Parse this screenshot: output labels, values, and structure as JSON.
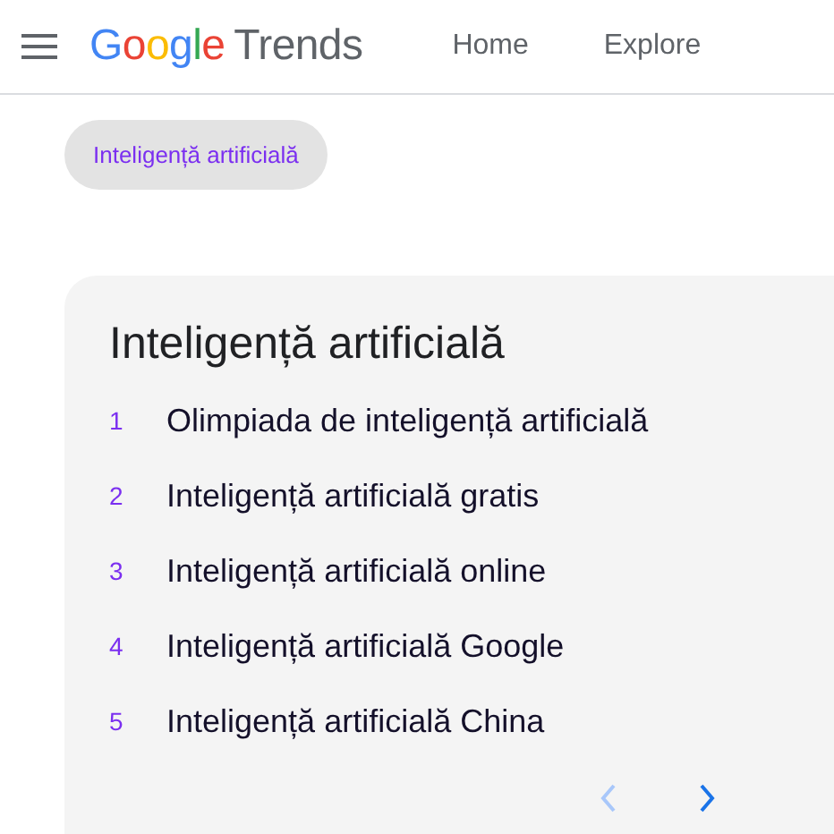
{
  "header": {
    "logo_letters": [
      {
        "text": "G",
        "color": "#4285f4"
      },
      {
        "text": "o",
        "color": "#ea4335"
      },
      {
        "text": "o",
        "color": "#fbbc05"
      },
      {
        "text": "g",
        "color": "#4285f4"
      },
      {
        "text": "l",
        "color": "#34a853"
      },
      {
        "text": "e",
        "color": "#ea4335"
      }
    ],
    "logo_product": "Trends",
    "nav": [
      {
        "label": "Home"
      },
      {
        "label": "Explore"
      }
    ]
  },
  "chip": {
    "label": "Inteligență artificială"
  },
  "card": {
    "title": "Inteligență artificială",
    "items": [
      {
        "rank": "1",
        "text": "Olimpiada de inteligență artificială"
      },
      {
        "rank": "2",
        "text": "Inteligență artificială gratis"
      },
      {
        "rank": "3",
        "text": "Inteligență artificială online"
      },
      {
        "rank": "4",
        "text": "Inteligență artificială Google"
      },
      {
        "rank": "5",
        "text": "Inteligență artificială China"
      }
    ],
    "pager": {
      "prev_disabled": true,
      "next_disabled": false
    }
  }
}
